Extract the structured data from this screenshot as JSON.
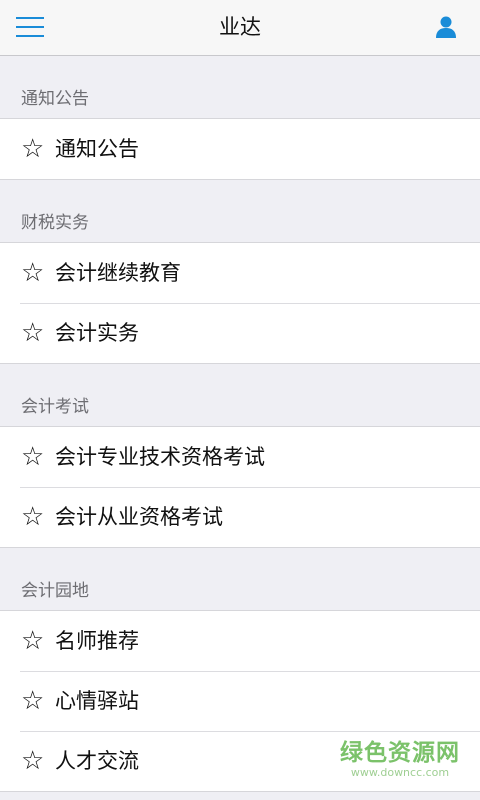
{
  "header": {
    "title": "业达",
    "menu_icon": "hamburger-menu-icon",
    "user_icon": "user-icon",
    "accent_color": "#1a8cd8"
  },
  "star_glyph": "☆",
  "sections": [
    {
      "title": "通知公告",
      "items": [
        {
          "label": "通知公告"
        }
      ]
    },
    {
      "title": "财税实务",
      "items": [
        {
          "label": "会计继续教育"
        },
        {
          "label": "会计实务"
        }
      ]
    },
    {
      "title": "会计考试",
      "items": [
        {
          "label": "会计专业技术资格考试"
        },
        {
          "label": "会计从业资格考试"
        }
      ]
    },
    {
      "title": "会计园地",
      "items": [
        {
          "label": "名师推荐"
        },
        {
          "label": "心情驿站"
        },
        {
          "label": "人才交流"
        }
      ]
    }
  ],
  "watermark": {
    "main": "绿色资源网",
    "sub": "www.downcc.com"
  }
}
